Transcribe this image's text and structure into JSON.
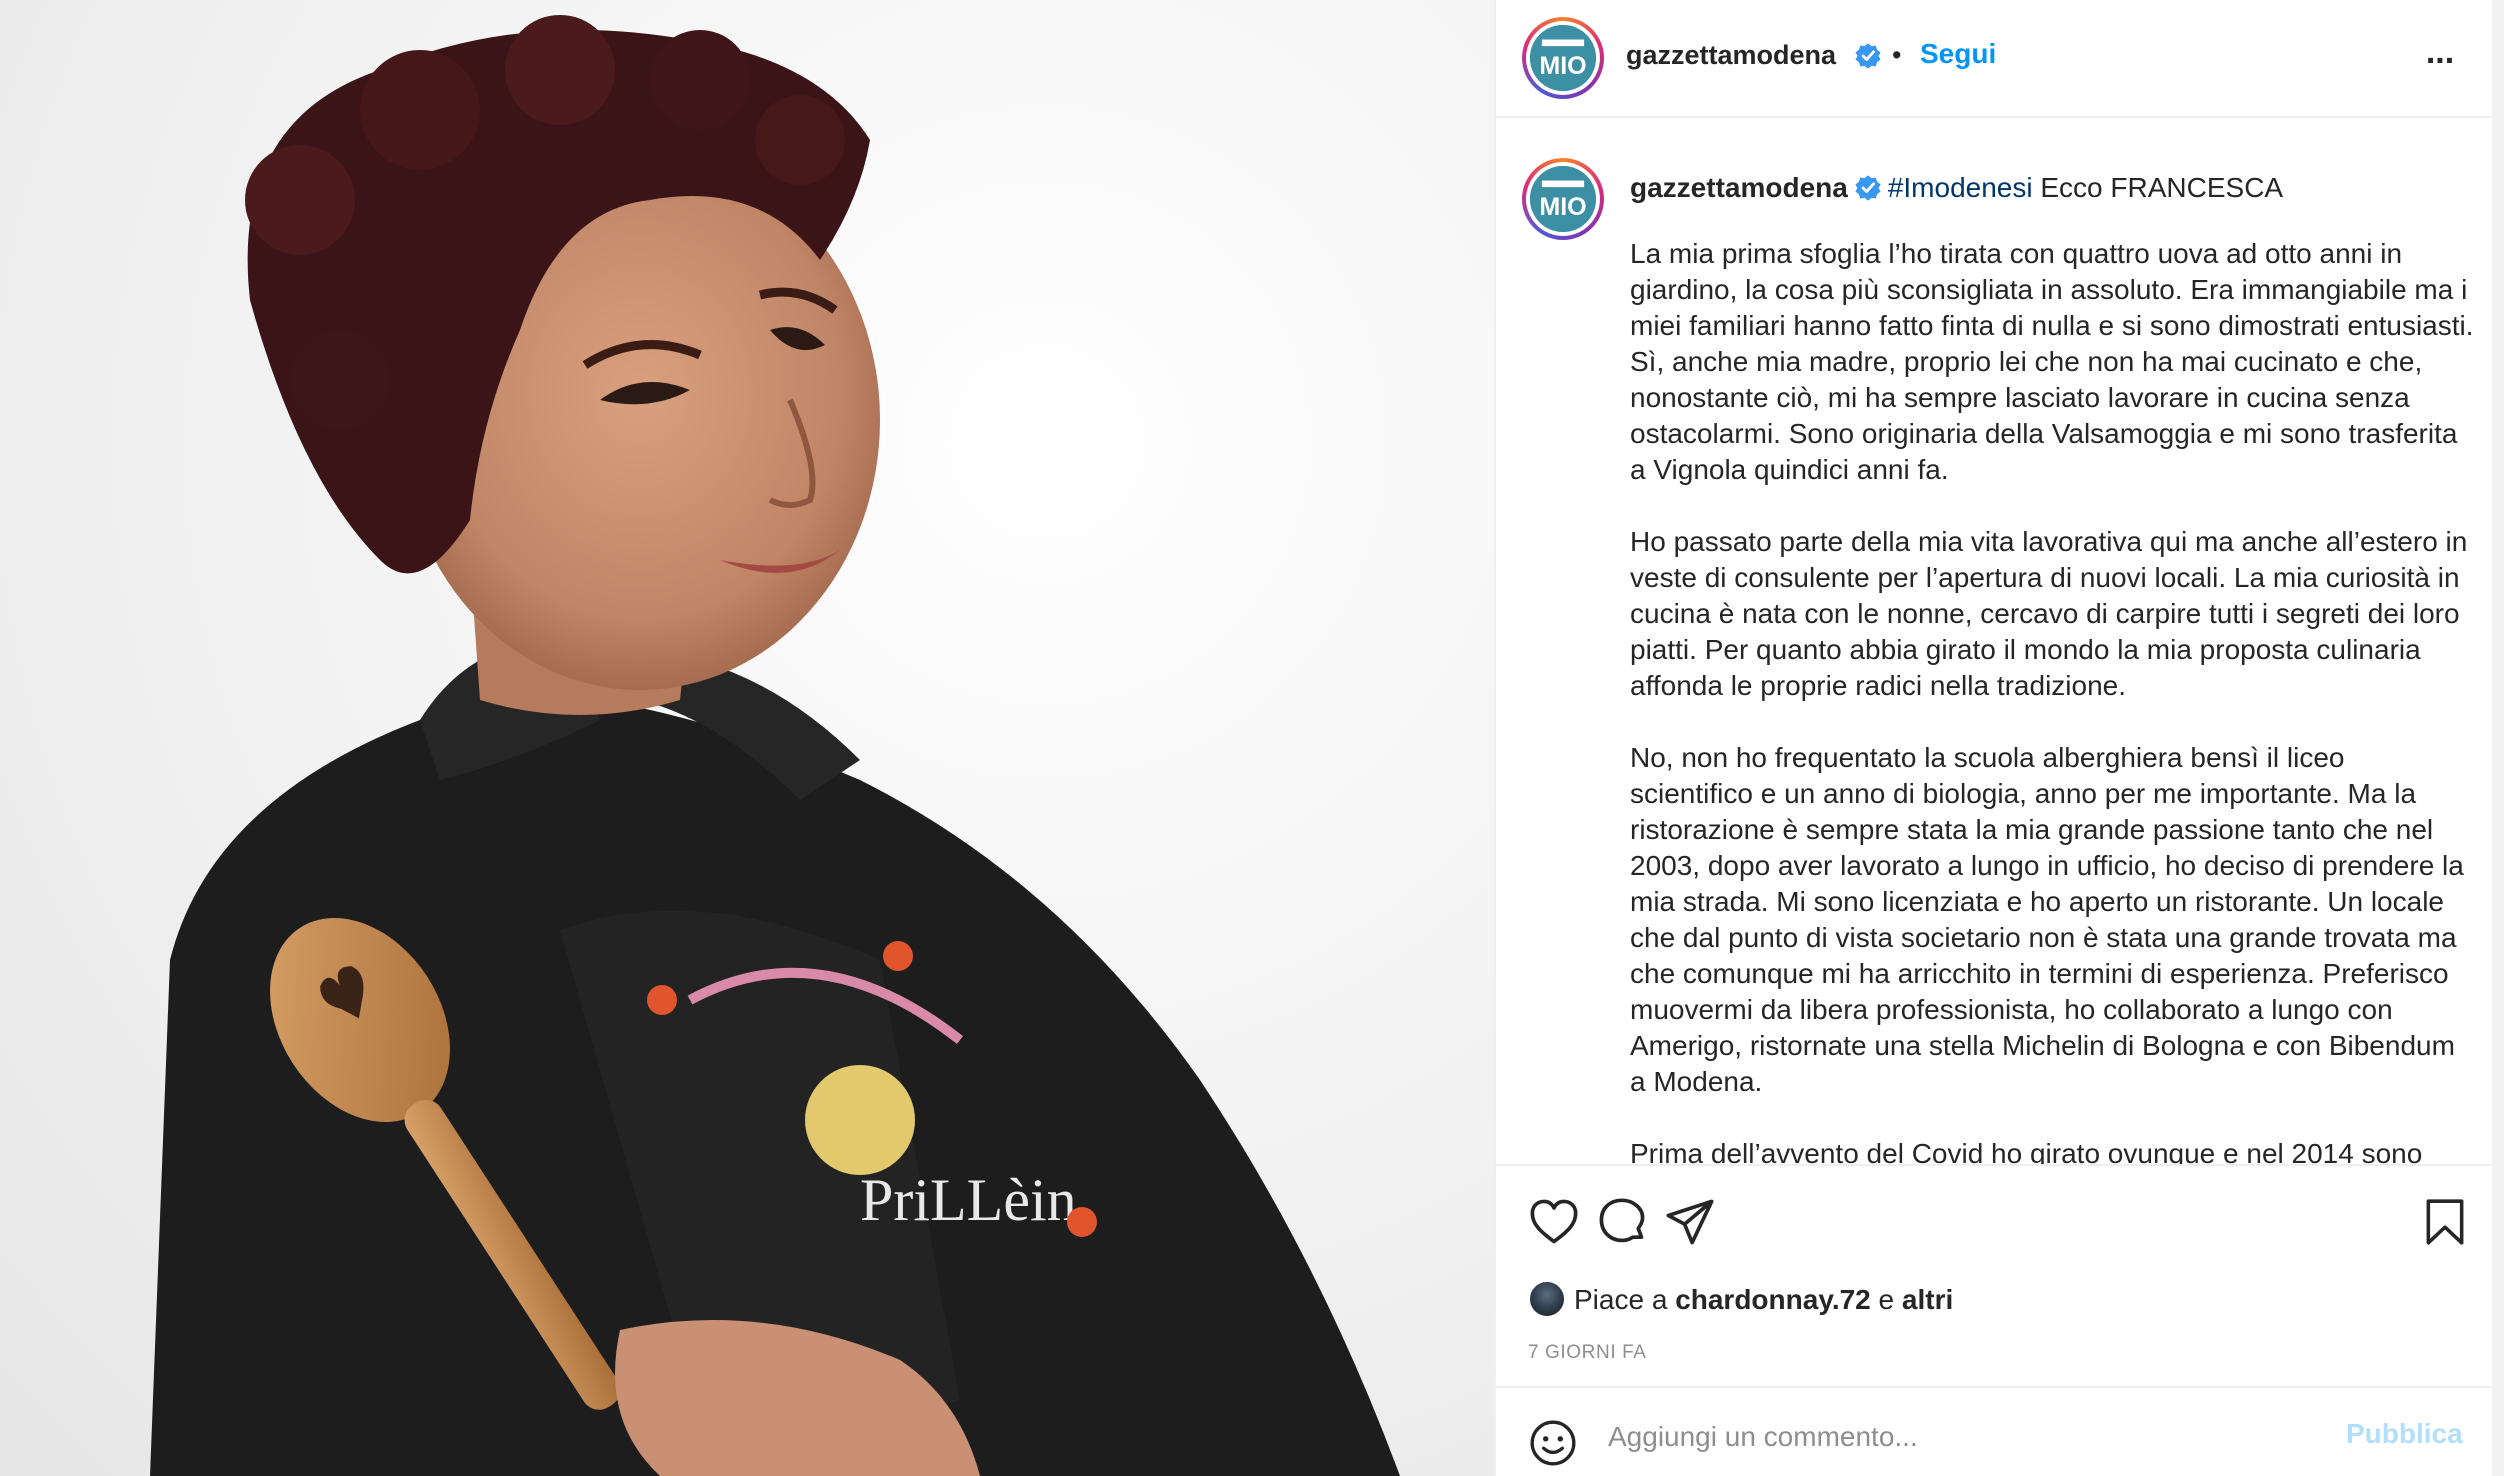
{
  "post": {
    "username": "gazzettamodena",
    "follow_label": "Segui",
    "separator": "•",
    "more_label": "...",
    "verified": true,
    "avatar_icon": "gazzetta-mio-logo",
    "photo_description_icon": "chef-with-wooden-spoon-photo"
  },
  "caption": {
    "username": "gazzettamodena",
    "hashtag": "#Imodenesi",
    "lead": "Ecco FRANCESCA",
    "paragraphs": [
      "La mia prima sfoglia l’ho tirata con quattro uova ad otto anni in giardino, la cosa più sconsigliata in assoluto. Era immangiabile ma i miei familiari hanno fatto finta di nulla e si sono dimostrati entusiasti. Sì, anche mia madre, proprio lei che non ha mai cucinato e che, nonostante ciò, mi ha sempre lasciato lavorare in cucina senza ostacolarmi. Sono originaria della Valsamoggia e mi sono trasferita a Vignola quindici anni fa.",
      "Ho passato parte della mia vita lavorativa qui ma anche all’estero in veste di consulente per l’apertura di nuovi locali. La mia curiosità in cucina è nata con le nonne, cercavo di carpire tutti i segreti dei loro piatti. Per quanto abbia girato il mondo la mia proposta culinaria affonda le proprie radici nella tradizione.",
      "No, non ho frequentato la scuola alberghiera bensì il liceo scientifico e un anno di biologia, anno per me importante. Ma la ristorazione è sempre stata la mia grande passione tanto che nel 2003, dopo aver lavorato a lungo in ufficio, ho deciso di prendere la mia strada. Mi sono licenziata e ho aperto un ristorante. Un locale che dal punto di vista societario non è stata una grande trovata ma che comunque mi ha arricchito in termini di esperienza. Preferisco muovermi da libera professionista, ho collaborato a lungo con Amerigo, ristornate una stella Michelin di Bologna e con Bibendum a Modena.",
      "Prima dell’avvento del Covid ho girato ovunque e nel 2014 sono"
    ]
  },
  "actions": {
    "like_icon": "heart-icon",
    "comment_icon": "comment-bubble-icon",
    "share_icon": "paper-plane-icon",
    "save_icon": "bookmark-icon"
  },
  "likes": {
    "prefix": "Piace a",
    "user": "chardonnay.72",
    "conjunction": "e",
    "others": "altri"
  },
  "timestamp": "7 GIORNI FA",
  "comment_box": {
    "placeholder": "Aggiungi un commento...",
    "value": "",
    "publish_label": "Pubblica",
    "emoji_icon": "emoji-smile-icon"
  },
  "colors": {
    "link_blue": "#0095f6",
    "hashtag_blue": "#00376b",
    "verified_blue": "#3897f0",
    "muted_gray": "#8e8e8e",
    "publish_disabled": "#b2dffc",
    "chef_jacket": "#1e1e1e",
    "hair": "#3a1416"
  }
}
